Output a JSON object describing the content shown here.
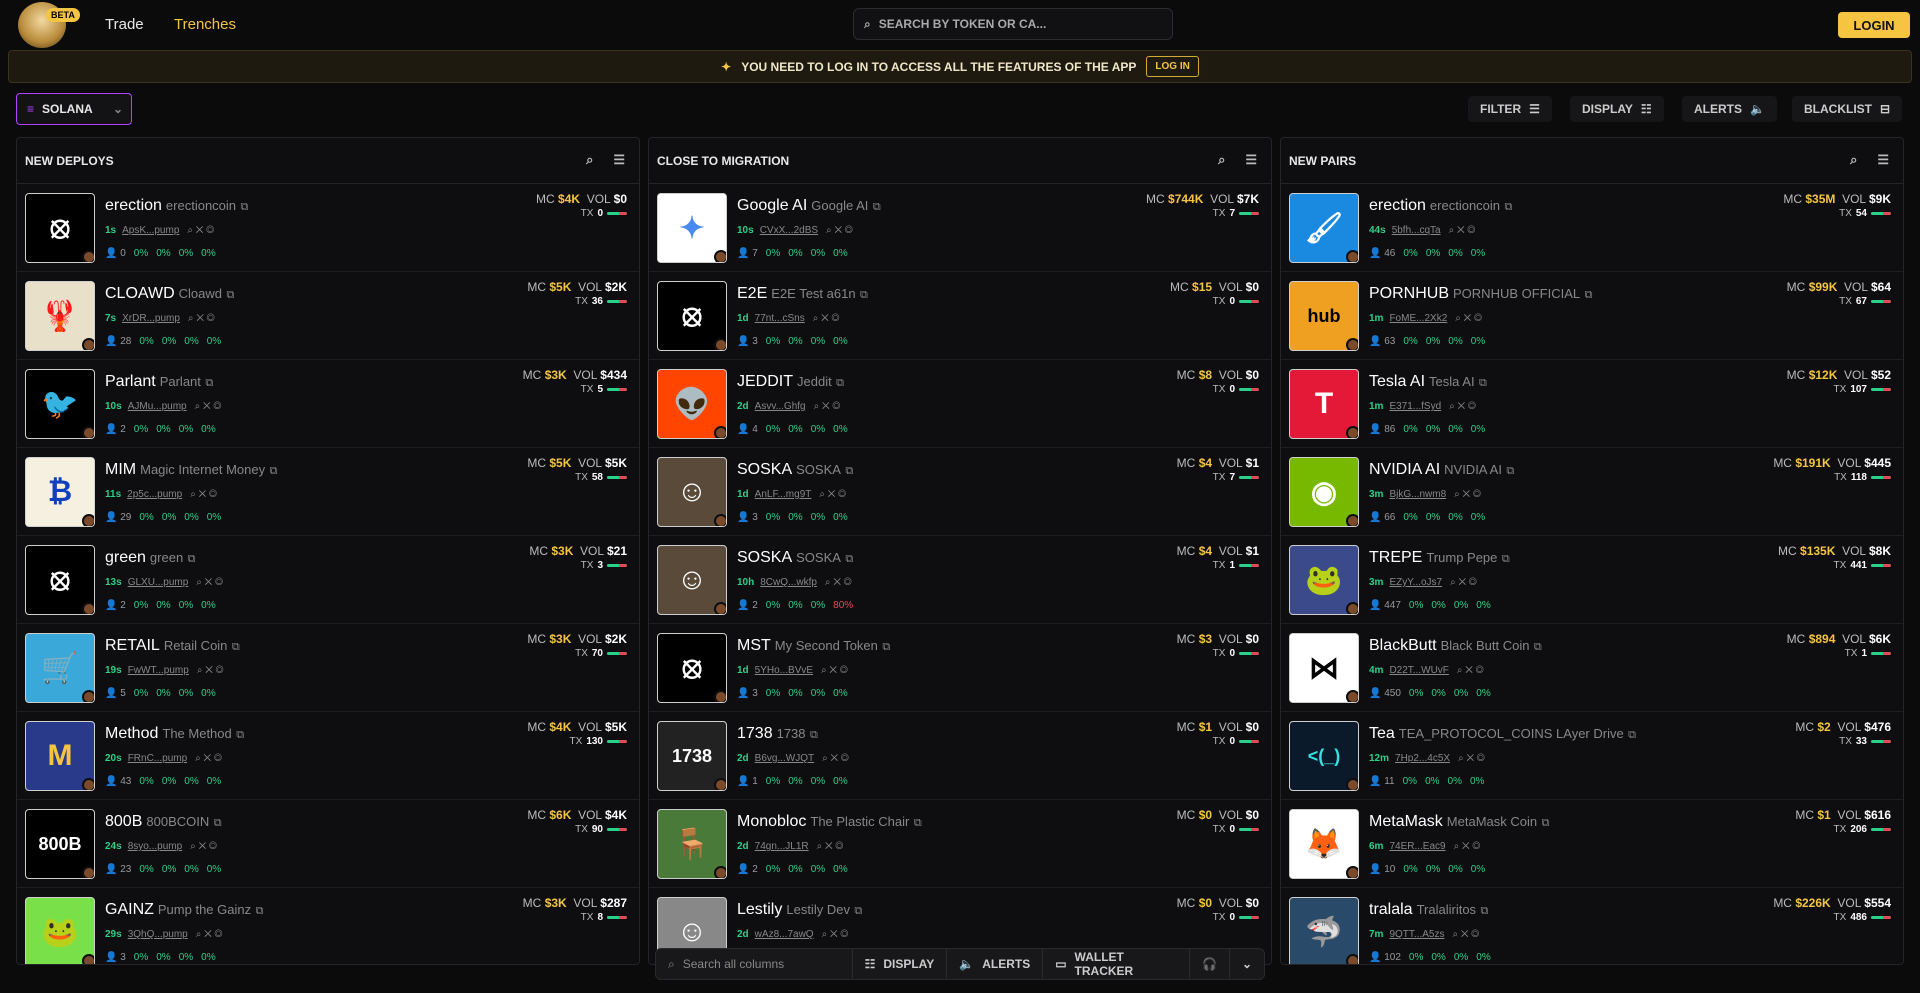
{
  "nav": {
    "beta": "BETA",
    "trade": "Trade",
    "trenches": "Trenches",
    "search_placeholder": "SEARCH BY TOKEN OR CA...",
    "login": "LOGIN"
  },
  "banner": {
    "text": "YOU NEED TO LOG IN TO ACCESS ALL THE FEATURES OF THE APP",
    "button": "LOG IN"
  },
  "toolbar": {
    "chain": "SOLANA",
    "filter": "FILTER",
    "display": "DISPLAY",
    "alerts": "ALERTS",
    "blacklist": "BLACKLIST"
  },
  "columns": [
    {
      "title": "NEW DEPLOYS",
      "rows": [
        {
          "sym": "erection",
          "name": "erectioncoin",
          "age": "1s",
          "ca": "ApsK...pump",
          "holders": "0",
          "mc": "$4K",
          "vol": "$0",
          "tx": "0",
          "icon": "coin-logo-icon",
          "bg": "#000",
          "fg": "#fff",
          "glyph": "⦻"
        },
        {
          "sym": "CLOAWD",
          "name": "Cloawd",
          "age": "7s",
          "ca": "XrDR...pump",
          "holders": "28",
          "mc": "$5K",
          "vol": "$2K",
          "tx": "36",
          "icon": "lobster-icon",
          "bg": "#e8e0c8",
          "fg": "#c03020",
          "glyph": "🦞"
        },
        {
          "sym": "Parlant",
          "name": "Parlant",
          "age": "10s",
          "ca": "AJMu...pump",
          "holders": "2",
          "mc": "$3K",
          "vol": "$434",
          "tx": "5",
          "icon": "bird-icon",
          "bg": "#000",
          "fg": "#fff",
          "glyph": "🐦"
        },
        {
          "sym": "MIM",
          "name": "Magic Internet Money",
          "age": "11s",
          "ca": "2p5c...pump",
          "holders": "29",
          "mc": "$5K",
          "vol": "$5K",
          "tx": "58",
          "icon": "meme-icon",
          "bg": "#f5f0e0",
          "fg": "#1040c0",
          "glyph": "₿"
        },
        {
          "sym": "green",
          "name": "green",
          "age": "13s",
          "ca": "GLXU...pump",
          "holders": "2",
          "mc": "$3K",
          "vol": "$21",
          "tx": "3",
          "icon": "coin-logo-icon",
          "bg": "#000",
          "fg": "#fff",
          "glyph": "⦻"
        },
        {
          "sym": "RETAIL",
          "name": "Retail Coin",
          "age": "19s",
          "ca": "FwWT...pump",
          "holders": "5",
          "mc": "$3K",
          "vol": "$2K",
          "tx": "70",
          "icon": "cart-icon",
          "bg": "#3aa8d8",
          "fg": "#fff",
          "glyph": "🛒"
        },
        {
          "sym": "Method",
          "name": "The Method",
          "age": "20s",
          "ca": "FRnC...pump",
          "holders": "43",
          "mc": "$4K",
          "vol": "$5K",
          "tx": "130",
          "icon": "method-icon",
          "bg": "#2a3a8a",
          "fg": "#f5c542",
          "glyph": "M"
        },
        {
          "sym": "800B",
          "name": "800BCOIN",
          "age": "24s",
          "ca": "8syo...pump",
          "holders": "23",
          "mc": "$6K",
          "vol": "$4K",
          "tx": "90",
          "icon": "text-logo-icon",
          "bg": "#000",
          "fg": "#fff",
          "glyph": "800B"
        },
        {
          "sym": "GAINZ",
          "name": "Pump the Gainz",
          "age": "29s",
          "ca": "3QhQ...pump",
          "holders": "3",
          "mc": "$3K",
          "vol": "$287",
          "tx": "8",
          "icon": "pepe-icon",
          "bg": "#7ae04a",
          "fg": "#000",
          "glyph": "🐸"
        }
      ]
    },
    {
      "title": "CLOSE TO MIGRATION",
      "rows": [
        {
          "sym": "Google AI",
          "name": "Google AI",
          "age": "10s",
          "ca": "CVxX...2dBS",
          "holders": "7",
          "mc": "$744K",
          "vol": "$7K",
          "tx": "7",
          "icon": "gemini-icon",
          "bg": "#fff",
          "fg": "#4a8af0",
          "glyph": "✦"
        },
        {
          "sym": "E2E",
          "name": "E2E Test a61n",
          "age": "1d",
          "ca": "77nt...cSns",
          "holders": "3",
          "mc": "$15",
          "vol": "$0",
          "tx": "0",
          "icon": "coin-logo-icon",
          "bg": "#000",
          "fg": "#fff",
          "glyph": "⦻"
        },
        {
          "sym": "JEDDIT",
          "name": "Jeddit",
          "age": "2d",
          "ca": "Asvv...Ghfg",
          "holders": "4",
          "mc": "$8",
          "vol": "$0",
          "tx": "0",
          "icon": "reddit-icon",
          "bg": "#ff4500",
          "fg": "#fff",
          "glyph": "👽"
        },
        {
          "sym": "SOSKA",
          "name": "SOSKA",
          "age": "1d",
          "ca": "AnLF...mg9T",
          "holders": "3",
          "mc": "$4",
          "vol": "$1",
          "tx": "7",
          "icon": "face-icon",
          "bg": "#5a4a3a",
          "fg": "#fff",
          "glyph": "☺"
        },
        {
          "sym": "SOSKA",
          "name": "SOSKA",
          "age": "10h",
          "ca": "8CwQ...wkfp",
          "holders": "2",
          "mc": "$4",
          "vol": "$1",
          "tx": "1",
          "icon": "face-icon",
          "bg": "#5a4a3a",
          "fg": "#fff",
          "glyph": "☺",
          "red": "80%"
        },
        {
          "sym": "MST",
          "name": "My Second Token",
          "age": "1d",
          "ca": "5YHo...BVvE",
          "holders": "3",
          "mc": "$3",
          "vol": "$0",
          "tx": "0",
          "icon": "coin-logo-icon",
          "bg": "#000",
          "fg": "#fff",
          "glyph": "⦻"
        },
        {
          "sym": "1738",
          "name": "1738",
          "age": "2d",
          "ca": "B6vg...WJQT",
          "holders": "1",
          "mc": "$1",
          "vol": "$0",
          "tx": "0",
          "icon": "number-icon",
          "bg": "#222",
          "fg": "#fff",
          "glyph": "1738"
        },
        {
          "sym": "Monobloc",
          "name": "The Plastic Chair",
          "age": "2d",
          "ca": "74gn...JL1R",
          "holders": "2",
          "mc": "$0",
          "vol": "$0",
          "tx": "0",
          "icon": "chair-icon",
          "bg": "#4a7a3a",
          "fg": "#fff",
          "glyph": "🪑"
        },
        {
          "sym": "Lestily",
          "name": "Lestily Dev",
          "age": "2d",
          "ca": "wAz8...7awQ",
          "holders": "1",
          "mc": "$0",
          "vol": "$0",
          "tx": "0",
          "icon": "portrait-icon",
          "bg": "#888",
          "fg": "#fff",
          "glyph": "☺"
        }
      ]
    },
    {
      "title": "NEW PAIRS",
      "rows": [
        {
          "sym": "erection",
          "name": "erectioncoin",
          "age": "44s",
          "ca": "5bfh...cqTa",
          "holders": "46",
          "mc": "$35M",
          "vol": "$9K",
          "tx": "54",
          "icon": "brush-icon",
          "bg": "#1a8ae0",
          "fg": "#fff",
          "glyph": "🖌"
        },
        {
          "sym": "PORNHUB",
          "name": "PORNHUB OFFICIAL",
          "age": "1m",
          "ca": "FoME...2Xk2",
          "holders": "63",
          "mc": "$99K",
          "vol": "$64",
          "tx": "67",
          "icon": "ph-logo-icon",
          "bg": "#f0a020",
          "fg": "#000",
          "glyph": "hub"
        },
        {
          "sym": "Tesla AI",
          "name": "Tesla AI",
          "age": "1m",
          "ca": "E371...fSyd",
          "holders": "86",
          "mc": "$12K",
          "vol": "$52",
          "tx": "107",
          "icon": "tesla-icon",
          "bg": "#e31937",
          "fg": "#fff",
          "glyph": "T"
        },
        {
          "sym": "NVIDIA AI",
          "name": "NVIDIA AI",
          "age": "3m",
          "ca": "BjkG...nwm8",
          "holders": "66",
          "mc": "$191K",
          "vol": "$445",
          "tx": "118",
          "icon": "nvidia-icon",
          "bg": "#76b900",
          "fg": "#fff",
          "glyph": "◉"
        },
        {
          "sym": "TREPE",
          "name": "Trump Pepe",
          "age": "3m",
          "ca": "EZyY...oJs7",
          "holders": "447",
          "mc": "$135K",
          "vol": "$8K",
          "tx": "441",
          "icon": "pepe-icon",
          "bg": "#3a4a8a",
          "fg": "#7ae04a",
          "glyph": "🐸"
        },
        {
          "sym": "BlackButt",
          "name": "Black Butt Coin",
          "age": "4m",
          "ca": "D22T...WUvF",
          "holders": "450",
          "mc": "$894",
          "vol": "$6K",
          "tx": "1",
          "icon": "abstract-icon",
          "bg": "#fff",
          "fg": "#000",
          "glyph": "⋈"
        },
        {
          "sym": "Tea",
          "name": "TEA_PROTOCOL_COINS LAyer Drive",
          "age": "12m",
          "ca": "7Hp2...4c5X",
          "holders": "11",
          "mc": "$2",
          "vol": "$476",
          "tx": "33",
          "icon": "code-icon",
          "bg": "#0a1a2a",
          "fg": "#3ae0e0",
          "glyph": "<(_)"
        },
        {
          "sym": "MetaMask",
          "name": "MetaMask Coin",
          "age": "6m",
          "ca": "74ER...Eac9",
          "holders": "10",
          "mc": "$1",
          "vol": "$616",
          "tx": "206",
          "icon": "fox-icon",
          "bg": "#fff",
          "fg": "#e2761b",
          "glyph": "🦊"
        },
        {
          "sym": "tralala",
          "name": "Tralaliritos",
          "age": "7m",
          "ca": "9QTT...A5zs",
          "holders": "102",
          "mc": "$226K",
          "vol": "$554",
          "tx": "486",
          "icon": "shark-icon",
          "bg": "#2a4a6a",
          "fg": "#fff",
          "glyph": "🦈"
        }
      ]
    }
  ],
  "stat_zero": "0%",
  "labels": {
    "mc": "MC",
    "vol": "VOL",
    "tx": "TX"
  },
  "bottom": {
    "search": "Search all columns",
    "display": "DISPLAY",
    "alerts": "ALERTS",
    "wallet": "WALLET TRACKER"
  }
}
